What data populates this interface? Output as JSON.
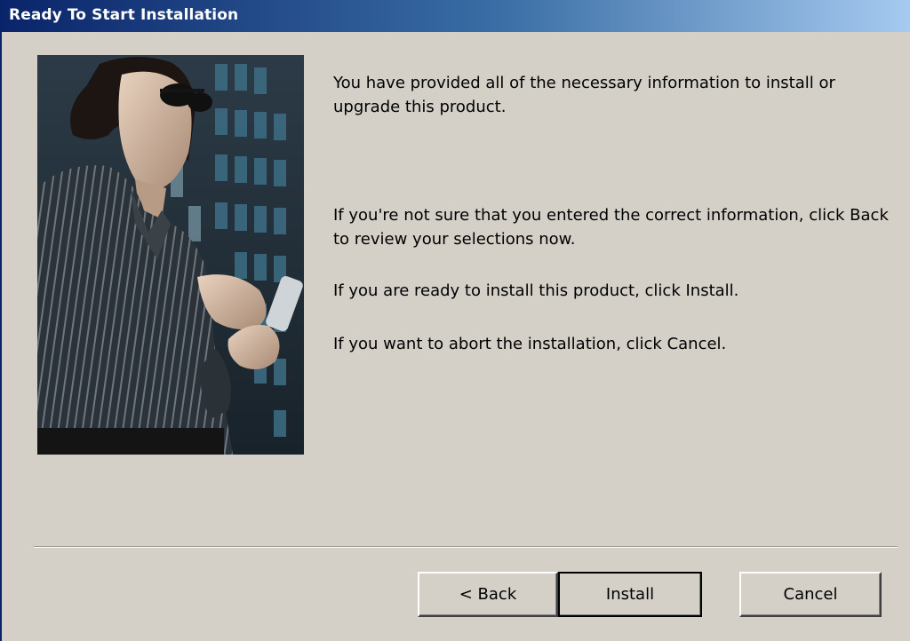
{
  "window": {
    "title": "Ready To Start Installation"
  },
  "content": {
    "paragraph1": "You have provided all of the necessary information to install or upgrade this product.",
    "paragraph2": "If you're not sure that you entered the correct information, click Back to review your selections now.",
    "paragraph3": "If you are ready to install this product, click Install.",
    "paragraph4": "If you want to abort the installation, click Cancel."
  },
  "buttons": {
    "back": "< Back",
    "install": "Install",
    "cancel": "Cancel"
  },
  "colors": {
    "titlebar_start": "#0a246a",
    "titlebar_end": "#a6caf0",
    "dialog_bg": "#d4d0c8"
  }
}
